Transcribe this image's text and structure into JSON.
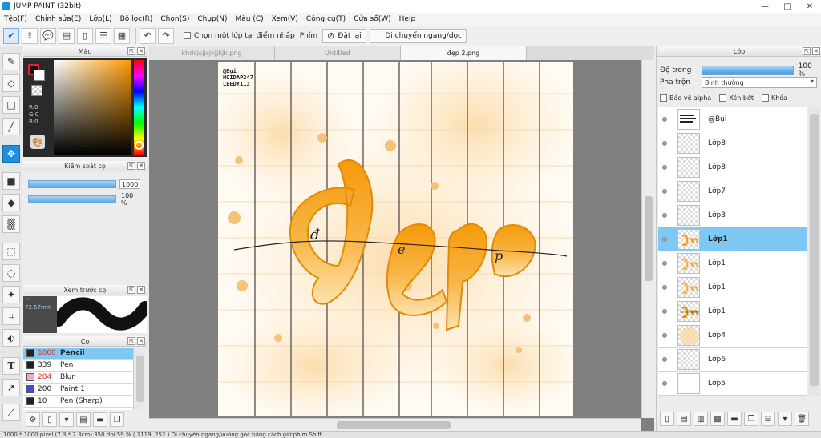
{
  "window": {
    "title": "JUMP PAINT (32bit)",
    "controls": [
      "—",
      "□",
      "✕"
    ]
  },
  "menu": [
    "Tệp(F)",
    "Chỉnh sửa(E)",
    "Lớp(L)",
    "Bộ lọc(R)",
    "Chọn(S)",
    "Chụp(N)",
    "Màu (C)",
    "Xem(V)",
    "Công cụ(T)",
    "Cửa sổ(W)",
    "Help"
  ],
  "toolbar": {
    "select_layer_label": "Chọn một lớp tại điểm nhấp",
    "key_label": "Phím",
    "reset_label": "Đặt lại",
    "move_label": "Di chuyển ngang/dọc"
  },
  "color_panel": {
    "title": "Màu",
    "rgb": [
      "R:0",
      "G:0",
      "B:0"
    ],
    "fg_color": "#111111",
    "hue_color": "#ff9a00"
  },
  "brush_control": {
    "title": "Kiểm soát cọ",
    "size_value": "1000",
    "opacity_value": "100 %"
  },
  "preview": {
    "title": "Xem trước cọ",
    "size_text": "^ 72.57mm"
  },
  "brushes": {
    "title": "Cọ",
    "items": [
      {
        "size": "1000",
        "name": "Pencil",
        "color": "#222222",
        "selected": true
      },
      {
        "size": "339",
        "name": "Pen",
        "color": "#222222",
        "selected": false
      },
      {
        "size": "284",
        "name": "Blur",
        "color": "#f3a6d6",
        "selected": false
      },
      {
        "size": "200",
        "name": "Paint 1",
        "color": "#3b4ed8",
        "selected": false
      },
      {
        "size": "10",
        "name": "Pen (Sharp)",
        "color": "#222222",
        "selected": false
      }
    ]
  },
  "tabs": [
    "khdcjsjjcjkjjkjk.png",
    "Untitled",
    "đẹp 2.png"
  ],
  "canvas": {
    "watermark": [
      "@Bụi",
      "HOIDAP247",
      "LEEDY113"
    ],
    "lettering": "Đẹp",
    "script_letters": [
      "đ",
      "e",
      "p"
    ]
  },
  "layers": {
    "title": "Lớp",
    "opacity_label": "Độ trong",
    "opacity_value": "100 %",
    "blend_label": "Pha trộn",
    "blend_value": "Bình thường",
    "checks": [
      "Bảo vệ alpha",
      "Xén bớt",
      "Khóa"
    ],
    "items": [
      {
        "name": "@Bụi",
        "selected": false,
        "kind": "text"
      },
      {
        "name": "Lớp8",
        "selected": false,
        "kind": "empty"
      },
      {
        "name": "Lớp8",
        "selected": false,
        "kind": "empty"
      },
      {
        "name": "Lớp7",
        "selected": false,
        "kind": "empty"
      },
      {
        "name": "Lớp3",
        "selected": false,
        "kind": "empty"
      },
      {
        "name": "Lớp1",
        "selected": true,
        "kind": "art"
      },
      {
        "name": "Lớp1",
        "selected": false,
        "kind": "art"
      },
      {
        "name": "Lớp1",
        "selected": false,
        "kind": "art"
      },
      {
        "name": "Lớp1",
        "selected": false,
        "kind": "art"
      },
      {
        "name": "Lớp4",
        "selected": false,
        "kind": "empty"
      },
      {
        "name": "Lớp6",
        "selected": false,
        "kind": "empty"
      },
      {
        "name": "Lớp5",
        "selected": false,
        "kind": "white"
      }
    ]
  },
  "status": "1000 * 1000 pixel  (7.3 * 7.3cm)  350 dpi  59 %  ( 1119, 252 )  Di chuyển ngang/vuông góc bằng cách giữ phím Shift"
}
